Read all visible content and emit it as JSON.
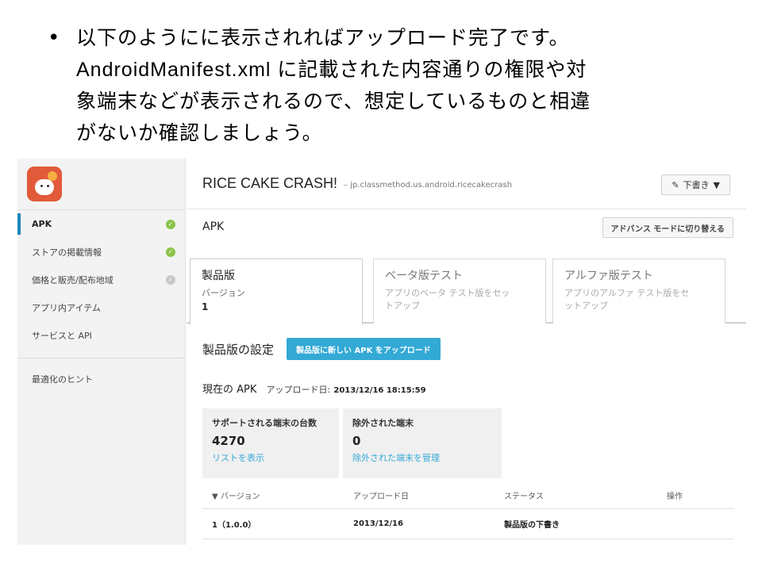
{
  "slide": {
    "bullet": "•",
    "lines": [
      "以下のようにに表示されればアップロード完了です。",
      "AndroidManifest.xml に記載された内容通りの権限や対",
      "象端末などが表示されるので、想定しているものと相違",
      "がないか確認しましょう。"
    ]
  },
  "sidebar": {
    "items": [
      {
        "label": "APK",
        "status": "ok"
      },
      {
        "label": "ストアの掲載情報",
        "status": "ok"
      },
      {
        "label": "価格と販売/配布地域",
        "status": "pending"
      },
      {
        "label": "アプリ内アイテム",
        "status": ""
      },
      {
        "label": "サービスと API",
        "status": ""
      }
    ],
    "hint": "最適化のヒント"
  },
  "header": {
    "app_title": "RICE CAKE CRASH!",
    "package": "– jp.classmethod.us.android.ricecakecrash",
    "draft_label": "下書き",
    "draft_caret": "▼",
    "pencil": "✎"
  },
  "apk": {
    "title": "APK",
    "advanced_button": "アドバンス モードに切り替える"
  },
  "tabs": [
    {
      "title": "製品版",
      "sub": "バージョン",
      "value": "1"
    },
    {
      "title": "ベータ版テスト",
      "sub": "アプリのベータ テスト版をセットアップ"
    },
    {
      "title": "アルファ版テスト",
      "sub": "アプリのアルファ テスト版をセットアップ"
    }
  ],
  "settings": {
    "title": "製品版の設定",
    "upload_button": "製品版に新しい APK をアップロード"
  },
  "current": {
    "label": "現在の APK",
    "date_label": "アップロード日:",
    "date": "2013/12/16 18:15:59"
  },
  "stats": [
    {
      "label": "サポートされる端末の台数",
      "value": "4270",
      "link": "リストを表示"
    },
    {
      "label": "除外された端末",
      "value": "0",
      "link": "除外された端末を管理"
    }
  ],
  "table": {
    "headers": [
      "▼ バージョン",
      "アップロード日",
      "ステータス",
      "操作"
    ],
    "rows": [
      [
        "1（1.0.0）",
        "2013/12/16",
        "製品版の下書き",
        ""
      ]
    ]
  }
}
